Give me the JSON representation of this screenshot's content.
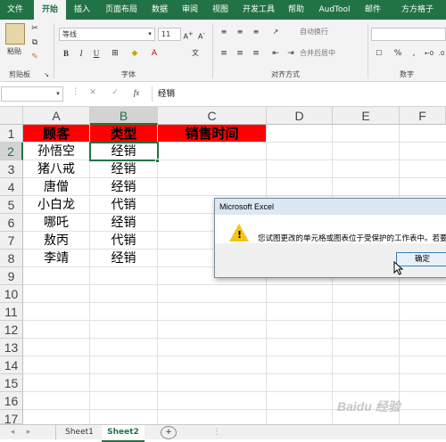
{
  "ribbon_tabs": [
    "文件",
    "开始",
    "插入",
    "页面布局",
    "数据",
    "审阅",
    "视图",
    "开发工具",
    "帮助",
    "AudTool",
    "邮件",
    "方方格子"
  ],
  "ribbon": {
    "paste_label": "粘贴",
    "clipboard_label": "剪贴板",
    "font_label": "字体",
    "align_label": "对齐方式",
    "number_label": "数字",
    "font_name": "等线",
    "font_size": "11",
    "wrap_text": "自动换行",
    "merge_center": "合并后居中",
    "bold": "B",
    "italic": "I",
    "underline": "U",
    "percent": "%",
    "comma": ","
  },
  "formula_bar": {
    "name_box": "",
    "fx": "fx",
    "cancel": "✕",
    "enter": "✓",
    "content": "经销"
  },
  "columns": [
    "A",
    "B",
    "C",
    "D",
    "E",
    "F"
  ],
  "rows": [
    "1",
    "2",
    "3",
    "4",
    "5",
    "6",
    "7",
    "8",
    "9",
    "10",
    "11",
    "12",
    "13",
    "14",
    "15",
    "16",
    "17"
  ],
  "cells": {
    "A1": "顾客",
    "B1": "类型",
    "C1": "销售时间",
    "A": [
      "孙悟空",
      "猪八戒",
      "唐僧",
      "小白龙",
      "哪吒",
      "敖丙",
      "李靖"
    ],
    "B": [
      "经销",
      "经销",
      "经销",
      "代销",
      "经销",
      "代销",
      "经销"
    ]
  },
  "sheets": [
    "Sheet1",
    "Sheet2"
  ],
  "active_sheet": "Sheet2",
  "dialog": {
    "title": "Microsoft Excel",
    "message": "您试图更改的单元格或图表位于受保护的工作表中。若要进行",
    "ok": "确定"
  },
  "watermark": "Baidu 经验",
  "colors": {
    "excel_green": "#217346",
    "header_red": "#ff0000"
  }
}
